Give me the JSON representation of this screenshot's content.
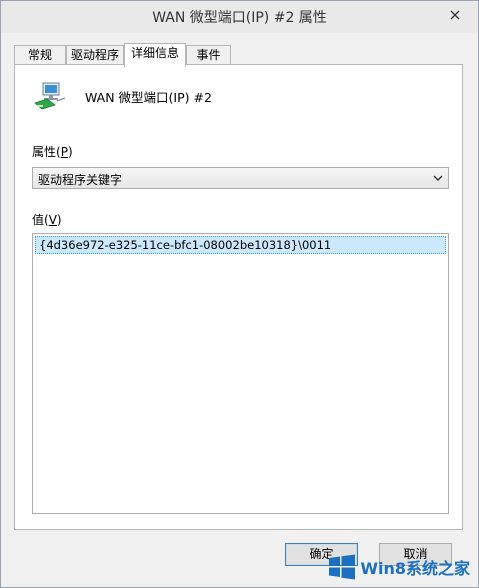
{
  "window": {
    "title": "WAN 微型端口(IP) #2 属性",
    "close_icon": "close-icon"
  },
  "tabs": [
    {
      "label": "常规",
      "active": false
    },
    {
      "label": "驱动程序",
      "active": false
    },
    {
      "label": "详细信息",
      "active": true
    },
    {
      "label": "事件",
      "active": false
    }
  ],
  "device": {
    "icon": "network-adapter-icon",
    "name": "WAN 微型端口(IP) #2"
  },
  "property": {
    "label_prefix": "属性(",
    "label_key": "P",
    "label_suffix": ")",
    "selected": "驱动程序关键字"
  },
  "value": {
    "label_prefix": "值(",
    "label_key": "V",
    "label_suffix": ")",
    "items": [
      "{4d36e972-e325-11ce-bfc1-08002be10318}\\0011"
    ]
  },
  "buttons": {
    "ok": "确定",
    "cancel": "取消"
  },
  "watermark": {
    "text": "Win8系统之家",
    "icon": "windows-logo-icon"
  },
  "colors": {
    "selection_bg": "#cce8ff",
    "selection_border": "#3399ff",
    "brand_blue": "#1d6fc0"
  }
}
